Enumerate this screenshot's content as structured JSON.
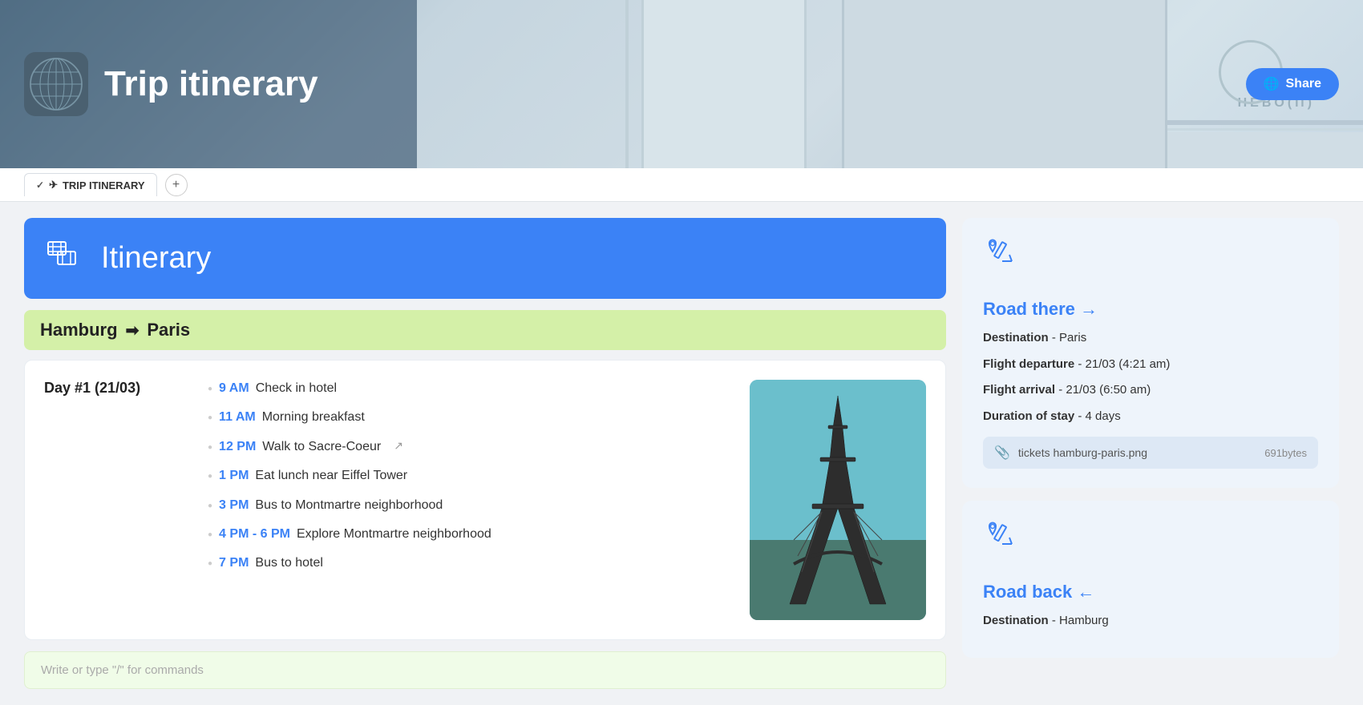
{
  "header": {
    "title": "Trip itinerary",
    "share_label": "Share"
  },
  "tabs": [
    {
      "id": "trip-itinerary",
      "label": "TRIP ITINERARY",
      "active": true,
      "has_check": true,
      "has_airplane": true
    }
  ],
  "add_tab_label": "+",
  "itinerary": {
    "section_title": "Itinerary",
    "route": {
      "from": "Hamburg",
      "to": "Paris",
      "arrow": "➡"
    },
    "day": {
      "label": "Day #1  (21/03)",
      "activities": [
        {
          "time": "9 AM",
          "text": "Check in hotel",
          "has_link": false
        },
        {
          "time": "11 AM",
          "text": "Morning breakfast",
          "has_link": false
        },
        {
          "time": "12 PM",
          "text": "Walk to Sacre-Coeur",
          "has_link": true
        },
        {
          "time": "1 PM",
          "text": "Eat lunch near Eiffel Tower",
          "has_link": false
        },
        {
          "time": "3 PM",
          "text": "Bus to Montmartre neighborhood",
          "has_link": false
        },
        {
          "time": "4 PM - 6 PM",
          "text": "Explore Montmartre neighborhood",
          "has_link": false
        },
        {
          "time": "7 PM",
          "text": "Bus to hotel",
          "has_link": false
        }
      ]
    },
    "write_placeholder": "Write or type \"/\" for commands"
  },
  "road_there": {
    "title": "Road there →",
    "destination_label": "Destination",
    "destination_value": "Paris",
    "flight_departure_label": "Flight departure",
    "flight_departure_value": "21/03 (4:21 am)",
    "flight_arrival_label": "Flight arrival",
    "flight_arrival_value": "21/03 (6:50 am)",
    "duration_label": "Duration of stay",
    "duration_value": "4 days",
    "attachment": {
      "name": "tickets hamburg-paris.png",
      "size": "691bytes"
    }
  },
  "road_back": {
    "title": "Road back ←",
    "destination_label": "Destination",
    "destination_value": "Hamburg"
  },
  "colors": {
    "accent_blue": "#3b82f6",
    "route_bg": "#d4f0a8",
    "card_bg": "#eef4fb",
    "header_bg": "#3b82f6"
  }
}
